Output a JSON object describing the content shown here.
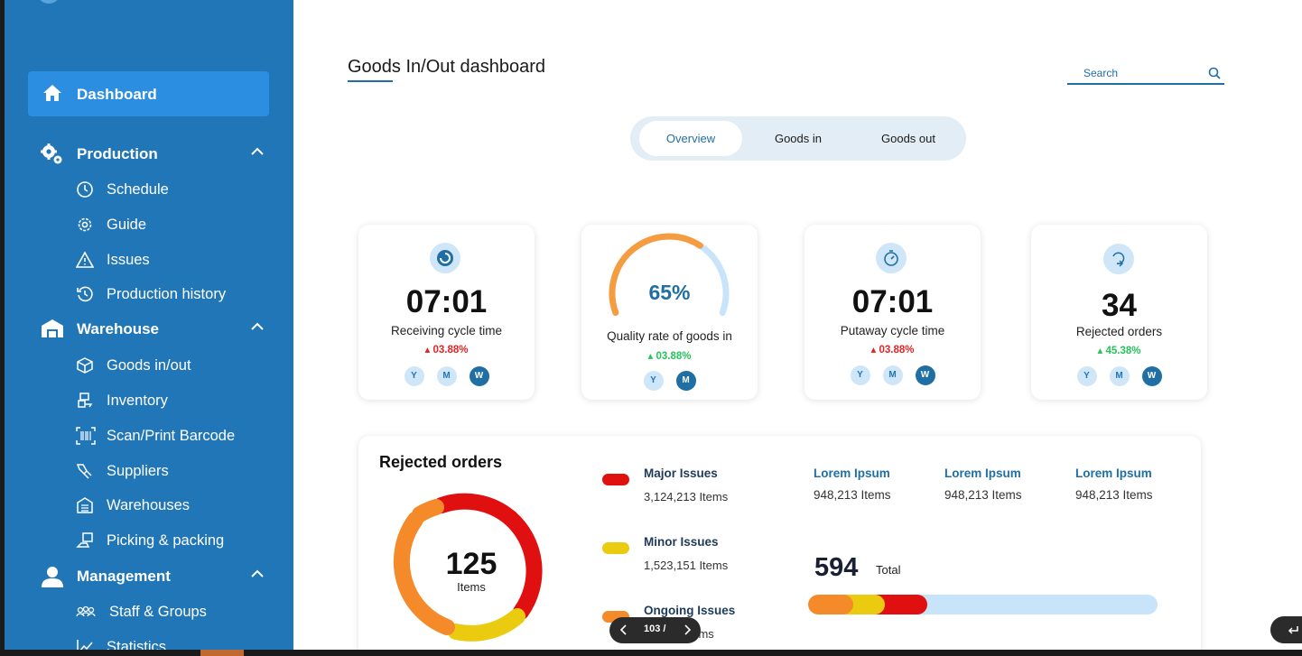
{
  "sidebar": {
    "active": {
      "label": "Dashboard",
      "icon": "home-icon"
    },
    "sections": [
      {
        "label": "Production",
        "icon": "gears-icon",
        "items": [
          {
            "label": "Schedule",
            "icon": "clock-icon"
          },
          {
            "label": "Guide",
            "icon": "gear-icon"
          },
          {
            "label": "Issues",
            "icon": "warning-icon"
          },
          {
            "label": "Production history",
            "icon": "history-icon"
          }
        ]
      },
      {
        "label": "Warehouse",
        "icon": "warehouse-icon",
        "items": [
          {
            "label": "Goods in/out",
            "icon": "box-icon"
          },
          {
            "label": "Inventory",
            "icon": "inventory-icon"
          },
          {
            "label": "Scan/Print Barcode",
            "icon": "barcode-icon"
          },
          {
            "label": "Suppliers",
            "icon": "supplier-icon"
          },
          {
            "label": "Warehouses",
            "icon": "building-icon"
          },
          {
            "label": "Picking & packing",
            "icon": "package-icon"
          }
        ]
      },
      {
        "label": "Management",
        "icon": "user-icon",
        "items": [
          {
            "label": "Staff & Groups",
            "icon": "group-icon"
          },
          {
            "label": "Statistics",
            "icon": "chart-icon"
          }
        ]
      }
    ]
  },
  "header": {
    "title": "Goods In/Out dashboard",
    "search_placeholder": "Search"
  },
  "tabs": [
    {
      "label": "Overview",
      "active": true
    },
    {
      "label": "Goods in",
      "active": false
    },
    {
      "label": "Goods out",
      "active": false
    }
  ],
  "kpis": [
    {
      "value": "07:01",
      "caption": "Receiving cycle time",
      "change": "03.88%",
      "direction": "down",
      "pills": [
        "Y",
        "M",
        "W"
      ],
      "active_pill": "W"
    },
    {
      "value": "65%",
      "caption": "Quality rate of goods in",
      "change": "03.88%",
      "direction": "up",
      "pills": [
        "Y",
        "M"
      ],
      "active_pill": "M",
      "gauge_fraction": 0.65
    },
    {
      "value": "07:01",
      "caption": "Putaway cycle time",
      "change": "03.88%",
      "direction": "down",
      "pills": [
        "Y",
        "M",
        "W"
      ],
      "active_pill": "W"
    },
    {
      "value": "34",
      "caption": "Rejected orders",
      "change": "45.38%",
      "direction": "up",
      "pills": [
        "Y",
        "M",
        "W"
      ],
      "active_pill": "W"
    }
  ],
  "rejected": {
    "title": "Rejected orders",
    "donut_value": "125",
    "donut_label": "Items",
    "legend": [
      {
        "name": "Major Issues",
        "count": "3,124,213 Items",
        "color": "#e01010"
      },
      {
        "name": "Minor Issues",
        "count": "1,523,151 Items",
        "color": "#eacb10"
      },
      {
        "name": "Ongoing Issues",
        "count": "Items",
        "color": "#f58a2a"
      }
    ],
    "lorem": [
      {
        "head": "Lorem Ipsum",
        "value": "948,213 Items"
      },
      {
        "head": "Lorem Ipsum",
        "value": "948,213 Items"
      },
      {
        "head": "Lorem Ipsum",
        "value": "948,213 Items"
      }
    ],
    "total_value": "594",
    "total_label": "Total",
    "bar_fractions": {
      "orange": 0.1,
      "yellow": 0.09,
      "red": 0.15
    }
  },
  "pager": {
    "text": "103 /"
  },
  "colors": {
    "primary": "#2176b8",
    "accent": "#1f6fa5",
    "red": "#e01010",
    "yellow": "#eacb10",
    "orange": "#f58a2a",
    "light": "#c8e4fb"
  }
}
